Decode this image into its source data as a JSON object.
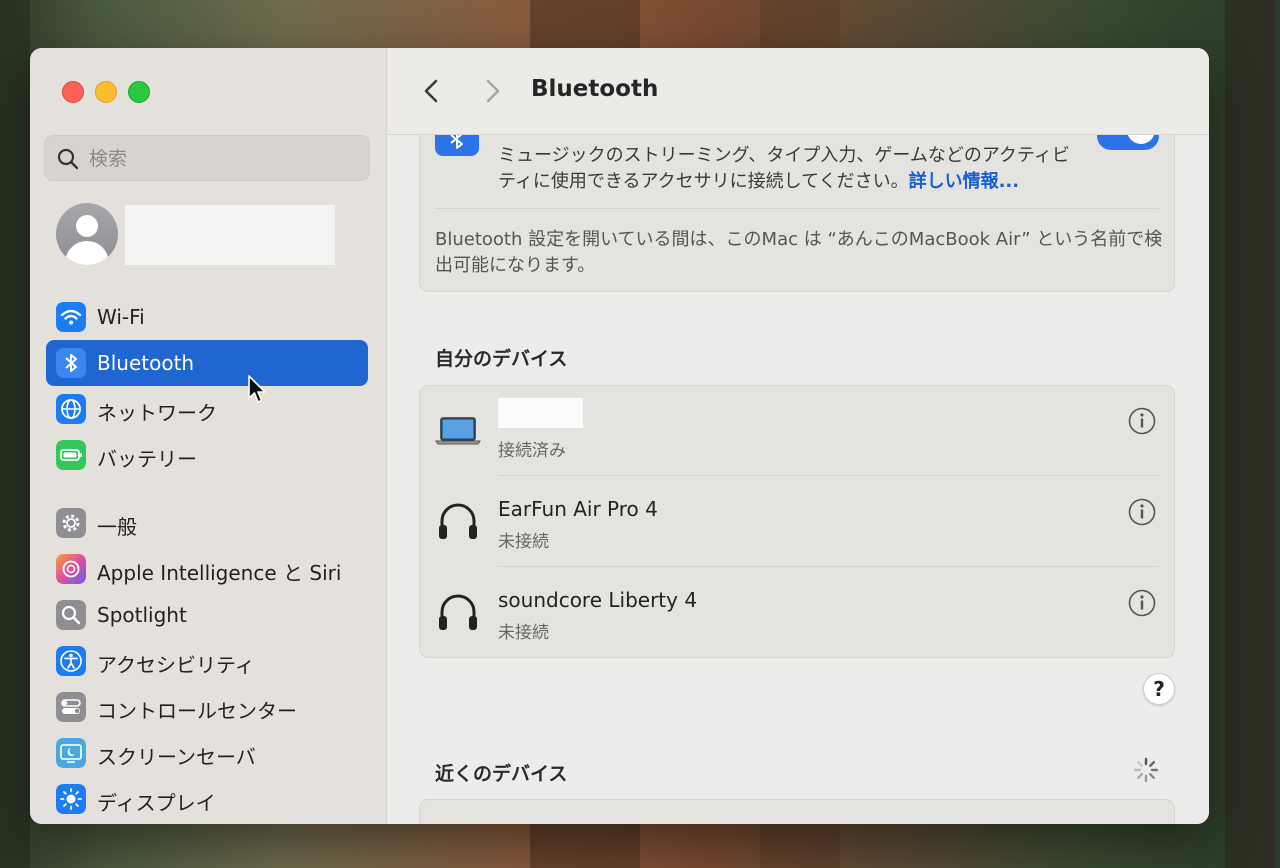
{
  "window": {
    "title": "Bluetooth"
  },
  "sidebar": {
    "search_placeholder": "検索",
    "items": [
      {
        "label": "Wi-Fi",
        "icon": "wifi-icon",
        "color": "#1e7cf2"
      },
      {
        "label": "Bluetooth",
        "icon": "bluetooth-icon",
        "color": "#1e7cf2",
        "selected": true
      },
      {
        "label": "ネットワーク",
        "icon": "globe-icon",
        "color": "#1e7cf2"
      },
      {
        "label": "バッテリー",
        "icon": "battery-icon",
        "color": "#34c759"
      },
      {
        "label": "一般",
        "icon": "gear-icon",
        "color": "#8e8e93"
      },
      {
        "label": "Apple Intelligence と Siri",
        "icon": "siri-icon",
        "color": "#c85ad8"
      },
      {
        "label": "Spotlight",
        "icon": "magnifier-icon",
        "color": "#8e8e93"
      },
      {
        "label": "アクセシビリティ",
        "icon": "accessibility-icon",
        "color": "#1e7cf2"
      },
      {
        "label": "コントロールセンター",
        "icon": "control-center-icon",
        "color": "#8e8e93"
      },
      {
        "label": "スクリーンセーバ",
        "icon": "screensaver-icon",
        "color": "#49a8e0"
      },
      {
        "label": "ディスプレイ",
        "icon": "display-icon",
        "color": "#1e7cf2"
      }
    ]
  },
  "bluetooth": {
    "description": "ミュージックのストリーミング、タイプ入力、ゲームなどのアクティビティに使用できるアクセサリに接続してください。",
    "details_link": "詳しい情報...",
    "discoverable_note": "Bluetooth 設定を開いている間は、このMac は “あんこのMacBook Air” という名前で検出可能になります。"
  },
  "my_devices": {
    "title": "自分のデバイス",
    "devices": [
      {
        "name": "",
        "status": "接続済み",
        "icon": "laptop-icon"
      },
      {
        "name": "EarFun Air Pro 4",
        "status": "未接続",
        "icon": "headphones-icon"
      },
      {
        "name": "soundcore Liberty 4",
        "status": "未接続",
        "icon": "headphones-icon"
      }
    ]
  },
  "help_label": "?",
  "nearby": {
    "title": "近くのデバイス"
  }
}
